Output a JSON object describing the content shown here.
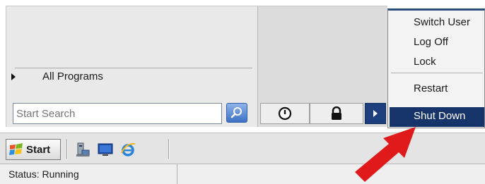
{
  "start_menu": {
    "all_programs_label": "All Programs",
    "search": {
      "placeholder": "Start Search"
    }
  },
  "shutdown_menu": {
    "items": [
      "Switch User",
      "Log Off",
      "Lock",
      "Restart",
      "Shut Down"
    ],
    "highlighted": "Shut Down"
  },
  "taskbar": {
    "start_label": "Start",
    "icons": [
      "server-manager-icon",
      "desktop-icon",
      "internet-explorer-icon"
    ]
  },
  "status_bar": {
    "text": "Status: Running"
  },
  "colors": {
    "highlight": "#16336a",
    "arrow": "#e01a1a"
  }
}
